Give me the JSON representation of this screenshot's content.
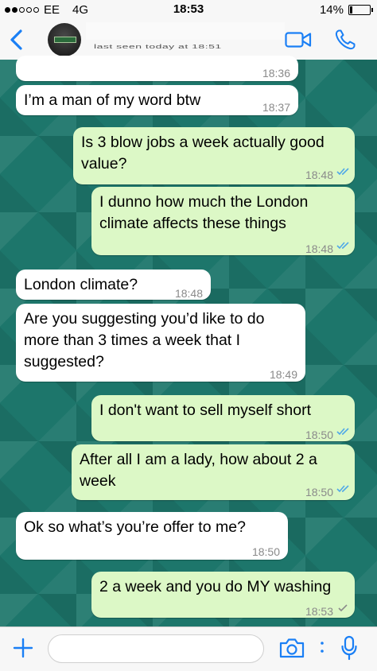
{
  "status": {
    "carrier": "EE",
    "network": "4G",
    "time": "18:53",
    "battery": "14%",
    "battery_level": 0.14
  },
  "header": {
    "subtitle": "last seen today at 18:51"
  },
  "messages": [
    {
      "dir": "in",
      "text": "",
      "time": "18:36"
    },
    {
      "dir": "in",
      "text": "I’m a man of my word btw",
      "time": "18:37"
    },
    {
      "dir": "out",
      "text": "Is 3 blow jobs a week actually good\nvalue?",
      "time": "18:48",
      "status": "read"
    },
    {
      "dir": "out",
      "text": "I dunno how much the London\nclimate affects these things",
      "time": "18:48",
      "status": "read"
    },
    {
      "dir": "in",
      "text": "London climate?",
      "time": "18:48"
    },
    {
      "dir": "in",
      "text": "Are you suggesting you’d like to do\nmore than 3 times a week that I\nsuggested?",
      "time": "18:49"
    },
    {
      "dir": "out",
      "text": "I don't want to sell myself short",
      "time": "18:50",
      "status": "read"
    },
    {
      "dir": "out",
      "text": "After all I am a lady, how about 2 a\nweek",
      "time": "18:50",
      "status": "read"
    },
    {
      "dir": "in",
      "text": "Ok so what’s you’re offer to me?",
      "time": "18:50"
    },
    {
      "dir": "out",
      "text": "2 a week and you do MY washing",
      "time": "18:53",
      "status": "sent"
    }
  ],
  "icons": {
    "back": "chevron-left-icon",
    "video": "video-camera-icon",
    "call": "phone-icon",
    "attach": "plus-icon",
    "camera": "camera-icon",
    "mic": "microphone-icon"
  },
  "colors": {
    "accent": "#1a7ff5",
    "incoming": "#ffffff",
    "outgoing": "#dcf8c6",
    "read_ticks": "#4fa8e8",
    "sent_tick": "#8a8a8a"
  }
}
